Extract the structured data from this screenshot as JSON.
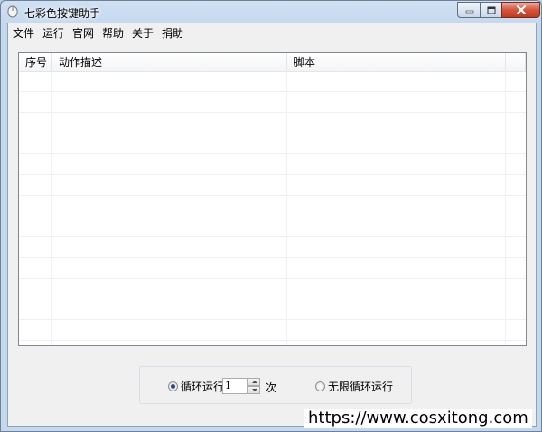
{
  "window": {
    "title": "七彩色按键助手"
  },
  "menu": {
    "items": [
      "文件",
      "运行",
      "官网",
      "帮助",
      "关于",
      "捐助"
    ]
  },
  "table": {
    "columns": [
      "序号",
      "动作描述",
      "脚本"
    ],
    "rows": []
  },
  "loop": {
    "loop_label": "循环运行",
    "count_value": "1",
    "times_label": "次",
    "infinite_label": "无限循环运行",
    "selected": "loop"
  },
  "watermark": "https://www.cosxitong.com",
  "colors": {
    "close_button": "#c23a1e",
    "title_bar": "#c4d8ee",
    "client_bg": "#f0f0f0"
  },
  "icons": {
    "app": "mouse-icon",
    "minimize": "minimize-icon",
    "maximize": "maximize-icon",
    "close": "close-icon"
  }
}
